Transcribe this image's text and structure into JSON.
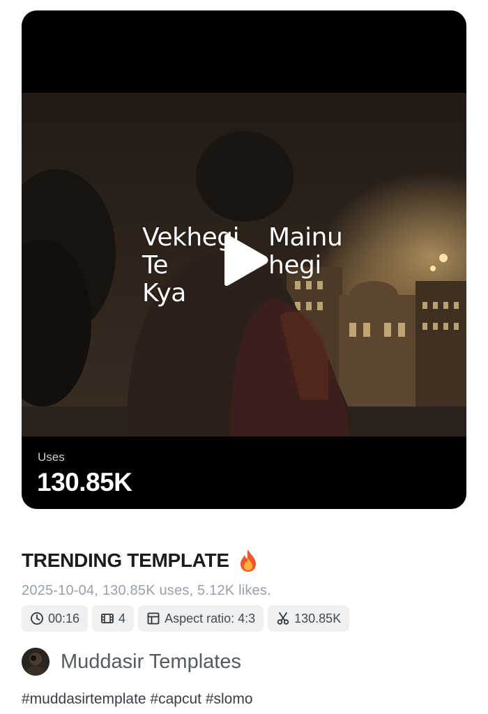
{
  "video": {
    "overlay_left": [
      "Vekhegi",
      "Te",
      "Kya"
    ],
    "overlay_right": [
      "Mainu",
      "hegi"
    ],
    "uses_label": "Uses",
    "uses_value": "130.85K"
  },
  "template": {
    "title": "TRENDING TEMPLATE",
    "title_emoji_icon": "fire-icon",
    "meta": "2025-10-04, 130.85K uses, 5.12K likes.",
    "chips": {
      "duration": "00:16",
      "clips": "4",
      "aspect_ratio": "Aspect ratio: 4:3",
      "uses": "130.85K"
    }
  },
  "author": {
    "name": "Muddasir Templates"
  },
  "hashtags": "#muddasirtemplate #capcut #slomo",
  "colors": {
    "card_bg": "#000000",
    "chip_bg": "#eef0f2",
    "meta_text": "#9aa0a8"
  }
}
